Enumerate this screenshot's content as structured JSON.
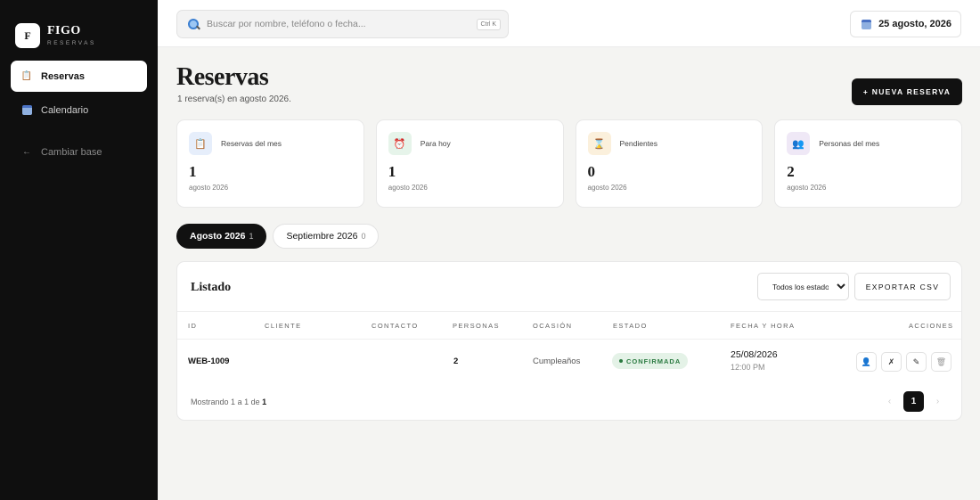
{
  "brand": {
    "logo_letter": "F",
    "name": "FIGO",
    "sub": "RESERVAS"
  },
  "sidebar": {
    "items": [
      {
        "label": "Reservas",
        "icon": "clipboard-icon",
        "active": true
      },
      {
        "label": "Calendario",
        "icon": "calendar-icon",
        "active": false
      }
    ],
    "back_label": "Cambiar base",
    "back_icon": "←"
  },
  "search": {
    "placeholder": "Buscar por nombre, teléfono o fecha...",
    "shortcut": "Ctrl K"
  },
  "header": {
    "date": "25 agosto, 2026"
  },
  "page": {
    "title": "Reservas",
    "subtitle": "1 reserva(s) en agosto 2026.",
    "new_button": "+ NUEVA RESERVA"
  },
  "stats": [
    {
      "label": "Reservas del mes",
      "value": "1",
      "sub": "agosto 2026",
      "icon": "📋",
      "icon_bg": "#e6eefb"
    },
    {
      "label": "Para hoy",
      "value": "1",
      "sub": "agosto 2026",
      "icon": "⏰",
      "icon_bg": "#e6f4ea"
    },
    {
      "label": "Pendientes",
      "value": "0",
      "sub": "agosto 2026",
      "icon": "⌛",
      "icon_bg": "#fbf0dc"
    },
    {
      "label": "Personas del mes",
      "value": "2",
      "sub": "agosto 2026",
      "icon": "👥",
      "icon_bg": "#efe8f6"
    }
  ],
  "month_tabs": [
    {
      "label": "Agosto 2026",
      "count": "1",
      "active": true
    },
    {
      "label": "Septiembre 2026",
      "count": "0",
      "active": false
    }
  ],
  "list": {
    "title": "Listado",
    "filter_selected": "Todos los estados",
    "export_label": "EXPORTAR CSV",
    "columns": [
      "ID",
      "CLIENTE",
      "CONTACTO",
      "PERSONAS",
      "OCASIÓN",
      "ESTADO",
      "FECHA Y HORA",
      "ACCIONES"
    ],
    "rows": [
      {
        "id": "WEB-1009",
        "cliente": "",
        "contacto": "",
        "personas": "2",
        "ocasion": "Cumpleaños",
        "estado": "CONFIRMADA",
        "fecha": "25/08/2026",
        "hora": "12:00 PM"
      }
    ],
    "actions": [
      {
        "icon": "👤",
        "name": "user-icon"
      },
      {
        "icon": "✗",
        "name": "cancel-icon"
      },
      {
        "icon": "✎",
        "name": "edit-icon"
      },
      {
        "icon": "🗑",
        "name": "trash-icon"
      }
    ],
    "footer": {
      "prefix": "Mostrando",
      "from": "1",
      "sep_a": "a",
      "to": "1",
      "sep_de": "de",
      "total": "1"
    },
    "pagination": {
      "prev": "‹",
      "current": "1",
      "next": "›"
    }
  },
  "colors": {
    "sidebar_bg": "#0f0f0f",
    "accent": "#111111",
    "success_bg": "#e4f2e7",
    "success_text": "#2a7a40"
  }
}
